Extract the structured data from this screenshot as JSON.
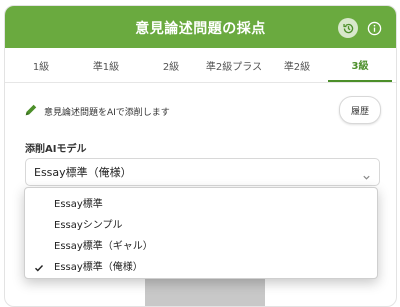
{
  "header": {
    "title": "意見論述問題の採点",
    "history_icon": "history-icon",
    "info_icon": "info-icon",
    "accent": "#6aaa3f"
  },
  "tabs": [
    {
      "label": "1級"
    },
    {
      "label": "準1級"
    },
    {
      "label": "2級"
    },
    {
      "label": "準2級プラス"
    },
    {
      "label": "準2級"
    },
    {
      "label": "3級",
      "active": true
    }
  ],
  "note": {
    "text": "意見論述問題をAIで添削します",
    "icon": "pencil-icon"
  },
  "history_button": {
    "label": "履歴"
  },
  "model": {
    "label": "添削AIモデル",
    "selected": "Essay標準（俺様）",
    "options": [
      {
        "label": "Essay標準",
        "checked": false
      },
      {
        "label": "Essayシンプル",
        "checked": false
      },
      {
        "label": "Essay標準（ギャル）",
        "checked": false
      },
      {
        "label": "Essay標準（俺様）",
        "checked": true
      }
    ]
  }
}
